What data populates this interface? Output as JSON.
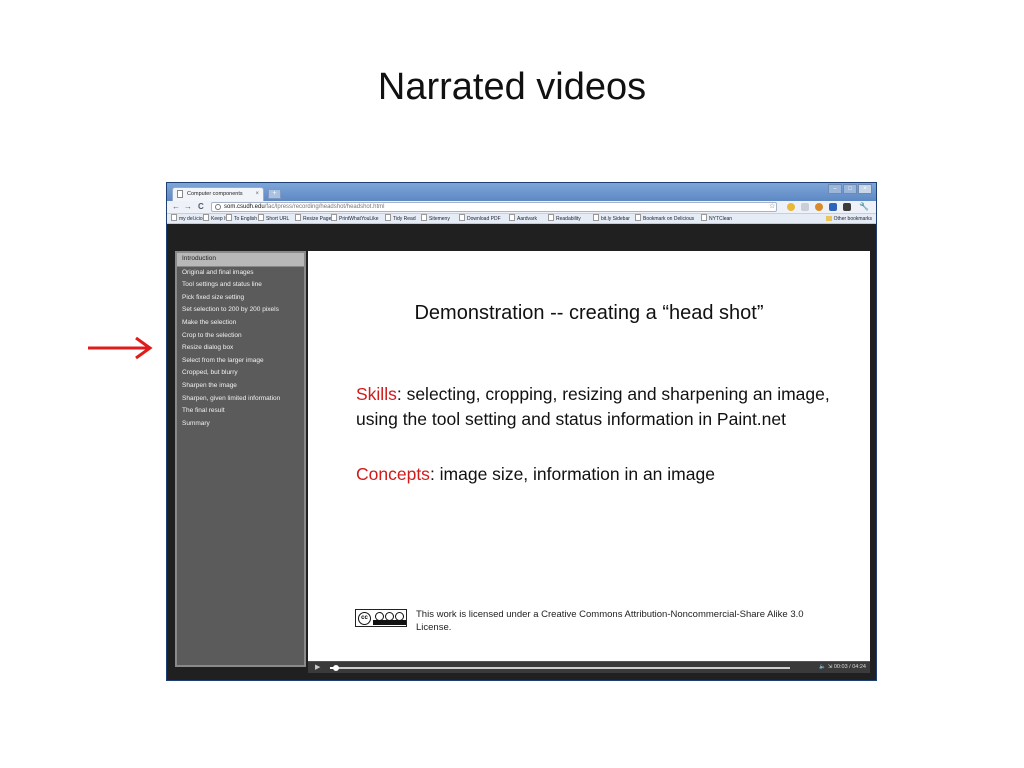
{
  "slide": {
    "title": "Narrated videos",
    "arrow_color": "#e01b1b"
  },
  "browser": {
    "tab_title": "Computer components",
    "tab_close": "×",
    "newtab_label": "+",
    "window_buttons": [
      "–",
      "□",
      "×"
    ],
    "nav": {
      "back": "←",
      "forward": "→",
      "reload": "C"
    },
    "url_domain": "som.csudh.edu",
    "url_path": "/fac/lpress/recording/headshot/headshot.html",
    "star": "☆",
    "bookmarks": [
      "my del.icio.us",
      "Keep It!",
      "To English",
      "Short URL",
      "Resize Page",
      "PrintWhatYouLike",
      "Tidy Read",
      "Sitemeny",
      "Download PDF",
      "Aardvark",
      "Readability",
      "bit.ly Sidebar",
      "Bookmark on Delicious",
      "NYTClean"
    ],
    "other_bookmarks": "Other bookmarks"
  },
  "toc": {
    "items": [
      "Introduction",
      "Original and final images",
      "Tool settings and status line",
      "Pick fixed size setting",
      "Set selection to 200 by 200 pixels",
      "Make the selection",
      "Crop to the selection",
      "Resize dialog box",
      "Select from the larger image",
      "Cropped, but blurry",
      "Sharpen the image",
      "Sharpen, given limited information",
      "The final result",
      "Summary"
    ],
    "active_index": 0
  },
  "stage": {
    "demo_title": "Demonstration -- creating a “head shot”",
    "skills_label": "Skills",
    "skills_text": ": selecting, cropping, resizing and sharpening an image, using the tool setting and status information in Paint.net",
    "concepts_label": "Concepts",
    "concepts_text": ": image size, information in an image",
    "cc_label": "cc",
    "license_text": "This work is licensed under a Creative Commons Attribution-Noncommercial-Share Alike 3.0 License."
  },
  "player": {
    "play_icon": "▶",
    "time": "00:03 / 04:24",
    "progress": 0.012
  }
}
